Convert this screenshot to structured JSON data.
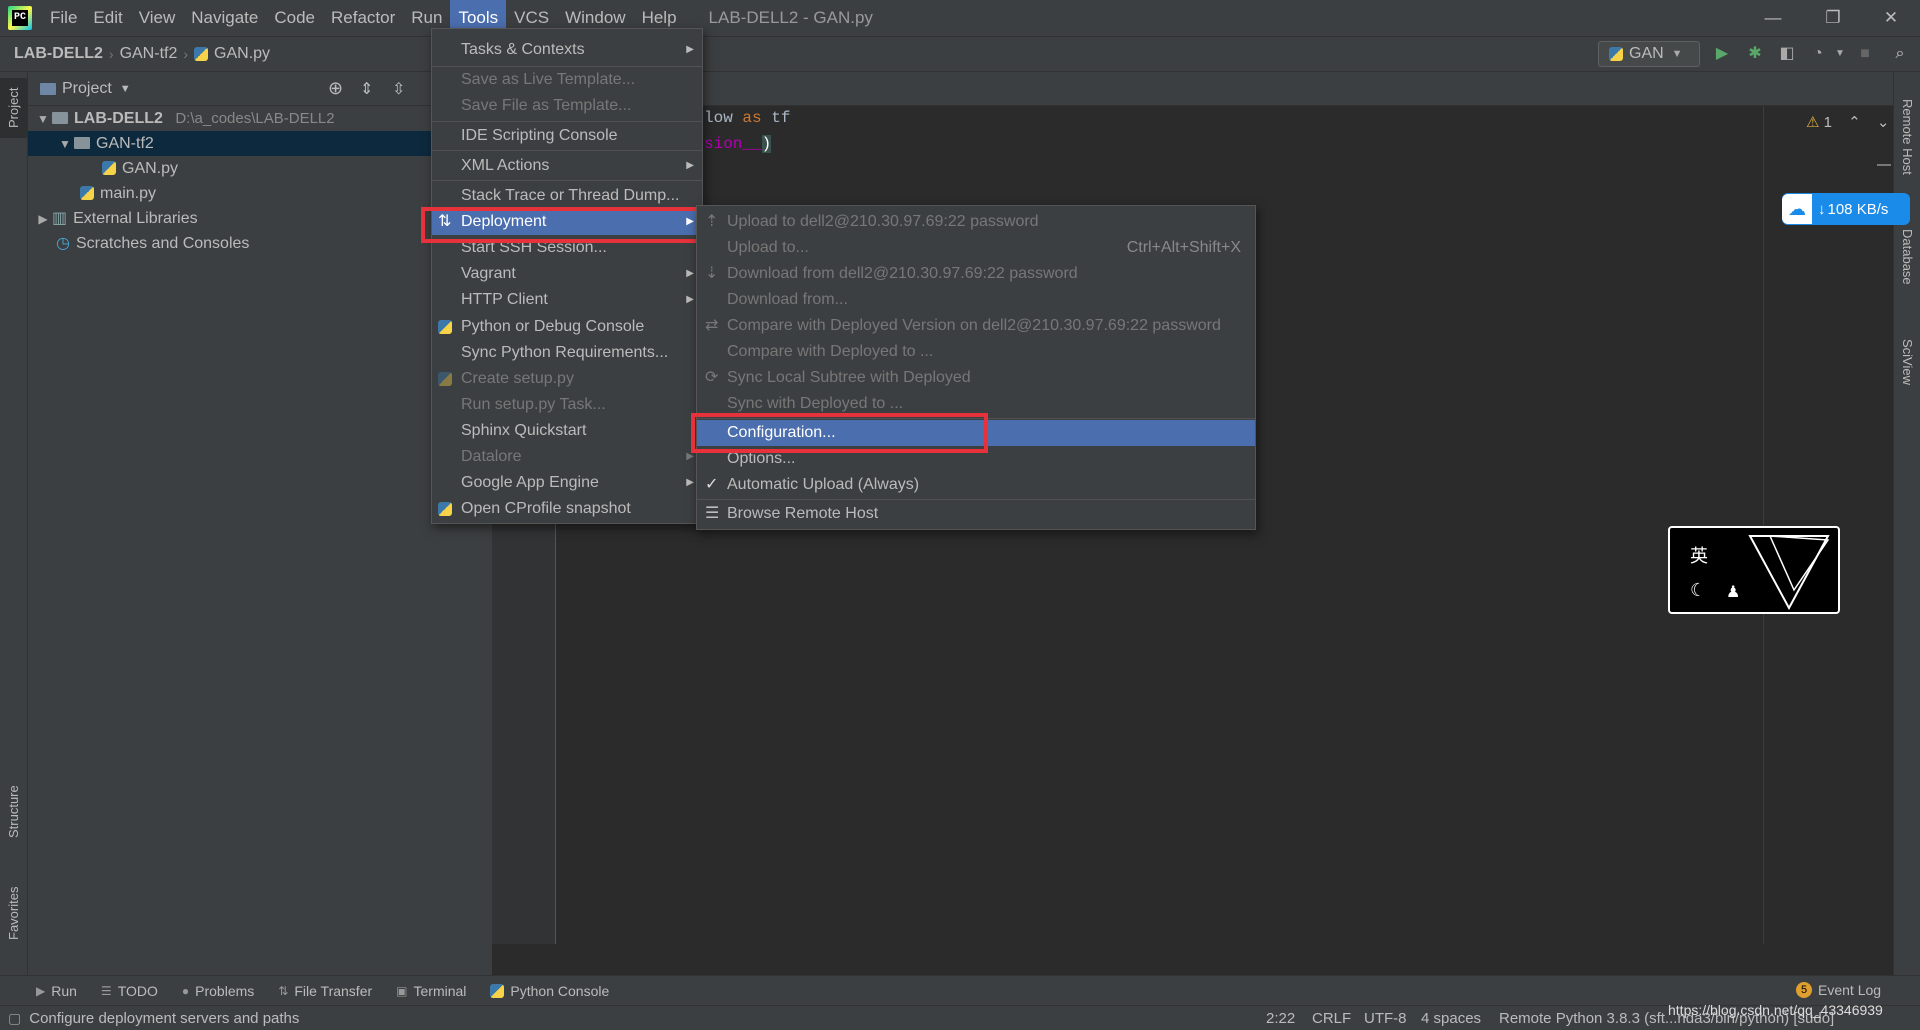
{
  "menubar": {
    "items": [
      "File",
      "Edit",
      "View",
      "Navigate",
      "Code",
      "Refactor",
      "Run",
      "Tools",
      "VCS",
      "Window",
      "Help"
    ],
    "title": "LAB-DELL2 - GAN.py"
  },
  "window_controls": {
    "minimize": "—",
    "restore": "❐",
    "close": "✕"
  },
  "breadcrumb": [
    "LAB-DELL2",
    "GAN-tf2",
    "GAN.py"
  ],
  "toolbar": {
    "run_config": "GAN"
  },
  "left_strip": {
    "project": "Project",
    "structure": "Structure",
    "favorites": "Favorites"
  },
  "project": {
    "title": "Project",
    "root_name": "LAB-DELL2",
    "root_path": "D:\\a_codes\\LAB-DELL2",
    "folder": "GAN-tf2",
    "file_gan": "GAN.py",
    "file_main": "main.py",
    "ext_libs": "External Libraries",
    "scratches": "Scratches and Consoles"
  },
  "right_strip": {
    "remote": "Remote Host",
    "database": "Database",
    "sciview": "SciView"
  },
  "editor": {
    "line1_a": "low",
    "line1_kw": "as",
    "line1_b": "tf",
    "line2": "sion__",
    "line2_paren": ")",
    "inspection_count": "1"
  },
  "tools_menu": {
    "items": [
      {
        "label": "Tasks & Contexts",
        "sub": true
      },
      {
        "label": "Save as Live Template...",
        "disabled": true
      },
      {
        "label": "Save File as Template...",
        "disabled": true
      },
      {
        "label": "IDE Scripting Console"
      },
      {
        "label": "XML Actions",
        "sub": true
      },
      {
        "label": "Stack Trace or Thread Dump..."
      },
      {
        "label": "Deployment",
        "sub": true,
        "highlighted": true
      },
      {
        "label": "Start SSH Session..."
      },
      {
        "label": "Vagrant",
        "sub": true
      },
      {
        "label": "HTTP Client",
        "sub": true
      },
      {
        "label": "Python or Debug Console"
      },
      {
        "label": "Sync Python Requirements..."
      },
      {
        "label": "Create setup.py",
        "disabled": true
      },
      {
        "label": "Run setup.py Task...",
        "disabled": true
      },
      {
        "label": "Sphinx Quickstart"
      },
      {
        "label": "Datalore",
        "sub": true,
        "disabled": true
      },
      {
        "label": "Google App Engine",
        "sub": true
      },
      {
        "label": "Open CProfile snapshot"
      }
    ]
  },
  "deploy_menu": {
    "items": [
      {
        "label": "Upload to dell2@210.30.97.69:22 password",
        "disabled": true
      },
      {
        "label": "Upload to...",
        "disabled": true,
        "shortcut": "Ctrl+Alt+Shift+X"
      },
      {
        "label": "Download from dell2@210.30.97.69:22 password",
        "disabled": true
      },
      {
        "label": "Download from...",
        "disabled": true
      },
      {
        "label": "Compare with Deployed Version on dell2@210.30.97.69:22 password",
        "disabled": true
      },
      {
        "label": "Compare with Deployed to ...",
        "disabled": true
      },
      {
        "label": "Sync Local Subtree with Deployed",
        "disabled": true
      },
      {
        "label": "Sync with Deployed to ...",
        "disabled": true
      },
      {
        "label": "Configuration...",
        "highlighted": true
      },
      {
        "label": "Options..."
      },
      {
        "label": "Automatic Upload (Always)",
        "checked": true
      },
      {
        "label": "Browse Remote Host"
      }
    ]
  },
  "netspeed": "108 KB/s",
  "ime": {
    "lang": "英"
  },
  "bottom_tools": [
    "Run",
    "TODO",
    "Problems",
    "File Transfer",
    "Terminal",
    "Python Console"
  ],
  "event_log": {
    "count": "5",
    "label": "Event Log"
  },
  "status": {
    "message": "Configure deployment servers and paths",
    "position": "2:22",
    "line_sep": "CRLF",
    "encoding": "UTF-8",
    "indent": "4 spaces",
    "interpreter": "Remote Python 3.8.3 (sft...nda3/bin/python) [sudo]",
    "watermark": "https://blog.csdn.net/qq_43346939"
  }
}
